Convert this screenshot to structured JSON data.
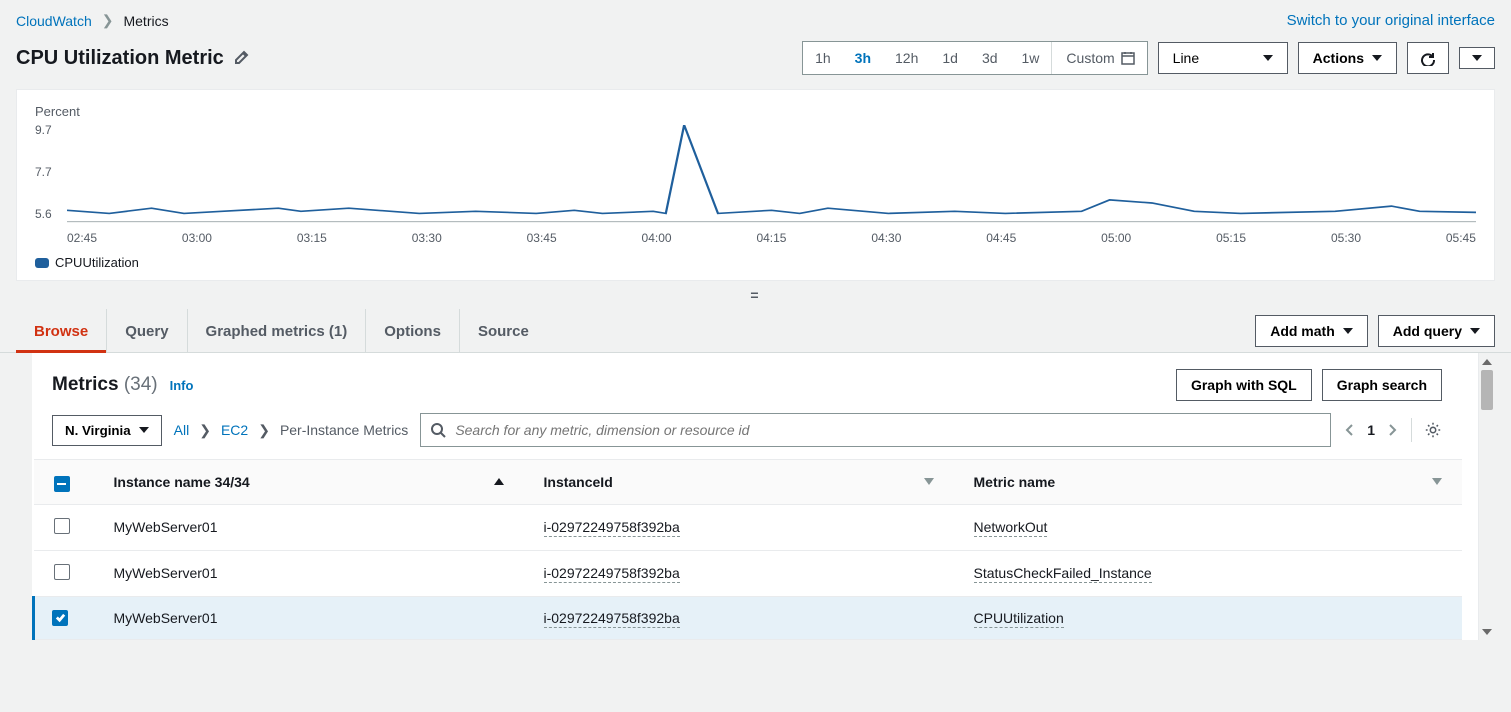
{
  "breadcrumb": {
    "root": "CloudWatch",
    "current": "Metrics"
  },
  "switch_link": "Switch to your original interface",
  "page_title": "CPU Utilization Metric",
  "time_ranges": [
    "1h",
    "3h",
    "12h",
    "1d",
    "3d",
    "1w"
  ],
  "time_active": "3h",
  "custom_label": "Custom",
  "chart_type": "Line",
  "actions_label": "Actions",
  "chart": {
    "ylabel": "Percent",
    "yticks": [
      "9.7",
      "7.7",
      "5.6"
    ],
    "xticks": [
      "02:45",
      "03:00",
      "03:15",
      "03:30",
      "03:45",
      "04:00",
      "04:15",
      "04:30",
      "04:45",
      "05:00",
      "05:15",
      "05:30",
      "05:45"
    ],
    "series": [
      {
        "name": "CPUUtilization",
        "color": "#1f5f9c"
      }
    ]
  },
  "chart_data": {
    "type": "line",
    "title": "CPU Utilization Metric",
    "ylabel": "Percent",
    "ylim": [
      5.6,
      9.7
    ],
    "x": [
      "02:45",
      "03:00",
      "03:15",
      "03:30",
      "03:45",
      "04:00",
      "04:15",
      "04:30",
      "04:45",
      "05:00",
      "05:15",
      "05:30",
      "05:45"
    ],
    "series": [
      {
        "name": "CPUUtilization",
        "color": "#1f5f9c",
        "values": [
          5.9,
          6.0,
          6.0,
          5.8,
          5.8,
          9.7,
          6.0,
          5.8,
          5.8,
          6.3,
          5.9,
          5.9,
          5.8
        ]
      }
    ]
  },
  "tabs": {
    "browse": "Browse",
    "query": "Query",
    "graphed": "Graphed metrics (1)",
    "options": "Options",
    "source": "Source"
  },
  "add_math": "Add math",
  "add_query": "Add query",
  "metrics_panel": {
    "title": "Metrics",
    "count": "(34)",
    "info": "Info",
    "graph_sql": "Graph with SQL",
    "graph_search": "Graph search"
  },
  "region": "N. Virginia",
  "crumbs": {
    "all": "All",
    "ec2": "EC2",
    "per": "Per-Instance Metrics"
  },
  "search_placeholder": "Search for any metric, dimension or resource id",
  "page": "1",
  "columns": {
    "instance": "Instance name 34/34",
    "instanceId": "InstanceId",
    "metric": "Metric name"
  },
  "rows": [
    {
      "checked": false,
      "name": "MyWebServer01",
      "id": "i-02972249758f392ba",
      "metric": "NetworkOut"
    },
    {
      "checked": false,
      "name": "MyWebServer01",
      "id": "i-02972249758f392ba",
      "metric": "StatusCheckFailed_Instance"
    },
    {
      "checked": true,
      "name": "MyWebServer01",
      "id": "i-02972249758f392ba",
      "metric": "CPUUtilization"
    }
  ]
}
